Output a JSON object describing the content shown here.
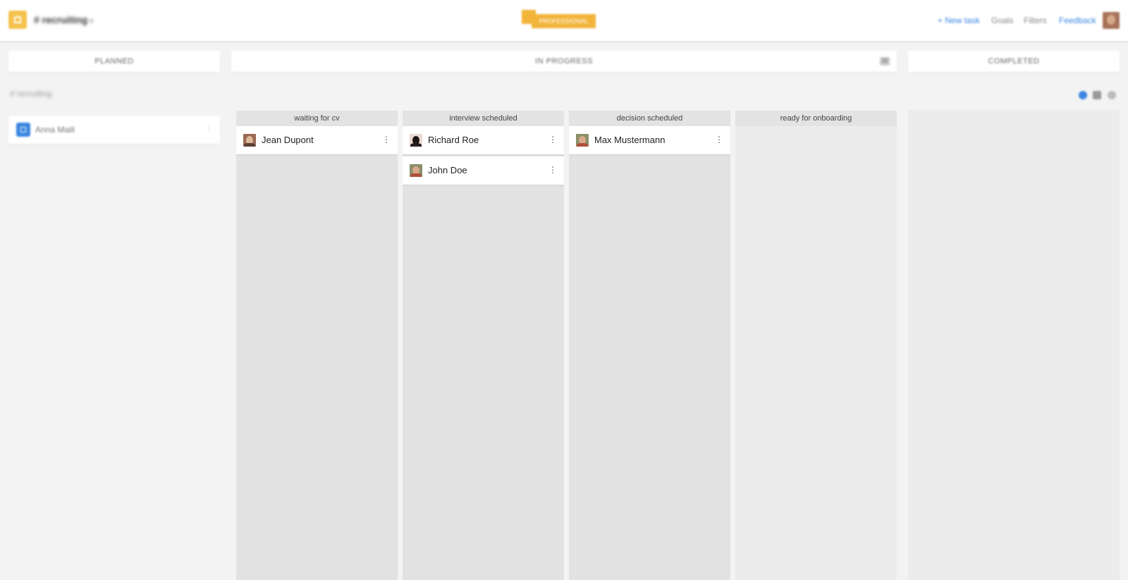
{
  "app": {
    "project_title": "# recruiting",
    "brand_label": "PROFESSIONAL",
    "nav": {
      "new_task": "+ New task",
      "goals": "Goals",
      "filters": "Filters",
      "feedback": "Feedback"
    }
  },
  "phases": {
    "planned": "PLANNED",
    "in_progress": "IN PROGRESS",
    "in_progress_count": "30",
    "completed": "COMPLETED"
  },
  "subproject": "# recruiting",
  "planned_items": [
    {
      "name": "Anna Maili"
    }
  ],
  "columns": [
    {
      "title": "waiting for cv",
      "cards": [
        {
          "name": "Jean Dupont"
        }
      ]
    },
    {
      "title": "interview scheduled",
      "cards": [
        {
          "name": "Richard Roe"
        },
        {
          "name": "John Doe"
        }
      ]
    },
    {
      "title": "decision scheduled",
      "cards": [
        {
          "name": "Max Mustermann"
        }
      ]
    },
    {
      "title": "ready for onboarding",
      "cards": []
    }
  ],
  "colors": {
    "accent_blue": "#3b86e0",
    "brand_orange": "#f2b43a",
    "column_bg": "#e1e2e1"
  }
}
